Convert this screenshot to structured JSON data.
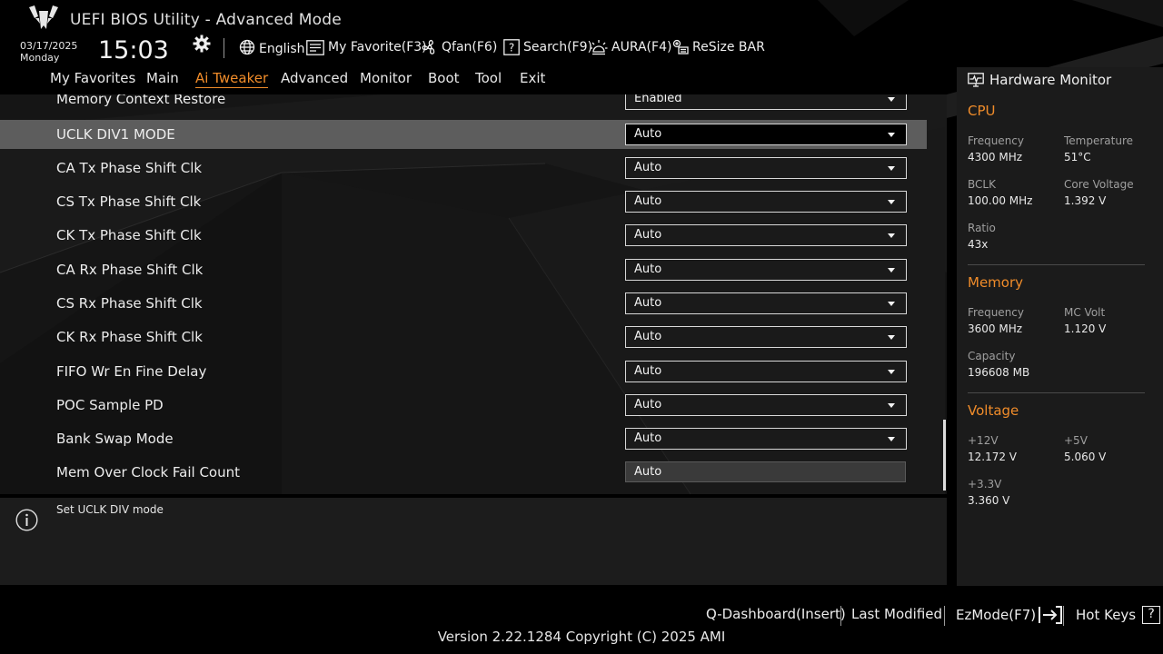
{
  "header": {
    "app_title": "UEFI BIOS Utility - Advanced Mode",
    "date": "03/17/2025",
    "day": "Monday",
    "time": "15:03",
    "toolbar": {
      "language": "English",
      "my_favorite": "My Favorite(F3)",
      "qfan": "Qfan(F6)",
      "search": "Search(F9)",
      "aura": "AURA(F4)",
      "resize_bar": "ReSize BAR"
    }
  },
  "tabs": [
    {
      "label": "My Favorites"
    },
    {
      "label": "Main"
    },
    {
      "label": "Ai Tweaker",
      "active": true
    },
    {
      "label": "Advanced"
    },
    {
      "label": "Monitor"
    },
    {
      "label": "Boot"
    },
    {
      "label": "Tool"
    },
    {
      "label": "Exit"
    }
  ],
  "settings": [
    {
      "label": "Memory Context Restore",
      "value": "Enabled"
    },
    {
      "label": "UCLK DIV1 MODE",
      "value": "Auto",
      "selected": true
    },
    {
      "label": "CA Tx Phase Shift Clk",
      "value": "Auto"
    },
    {
      "label": "CS Tx Phase Shift Clk",
      "value": "Auto"
    },
    {
      "label": "CK Tx Phase Shift Clk",
      "value": "Auto"
    },
    {
      "label": "CA Rx Phase Shift Clk",
      "value": "Auto"
    },
    {
      "label": "CS Rx Phase Shift Clk",
      "value": "Auto"
    },
    {
      "label": "CK Rx Phase Shift Clk",
      "value": "Auto"
    },
    {
      "label": "FIFO Wr En Fine Delay",
      "value": "Auto"
    },
    {
      "label": "POC Sample PD",
      "value": "Auto"
    },
    {
      "label": "Bank Swap Mode",
      "value": "Auto"
    },
    {
      "label": "Mem Over Clock Fail Count",
      "value": "Auto",
      "input": true
    }
  ],
  "help": {
    "text": "Set UCLK DIV mode"
  },
  "hardware_monitor": {
    "title": "Hardware Monitor",
    "cpu": {
      "heading": "CPU",
      "frequency_label": "Frequency",
      "frequency": "4300 MHz",
      "temperature_label": "Temperature",
      "temperature": "51°C",
      "bclk_label": "BCLK",
      "bclk": "100.00 MHz",
      "core_voltage_label": "Core Voltage",
      "core_voltage": "1.392 V",
      "ratio_label": "Ratio",
      "ratio": "43x"
    },
    "memory": {
      "heading": "Memory",
      "frequency_label": "Frequency",
      "frequency": "3600 MHz",
      "mc_volt_label": "MC Volt",
      "mc_volt": "1.120 V",
      "capacity_label": "Capacity",
      "capacity": "196608 MB"
    },
    "voltage": {
      "heading": "Voltage",
      "v12_label": "+12V",
      "v12": "12.172 V",
      "v5_label": "+5V",
      "v5": "5.060 V",
      "v33_label": "+3.3V",
      "v33": "3.360 V"
    }
  },
  "footer": {
    "q_dashboard": "Q-Dashboard(Insert)",
    "last_modified": "Last Modified",
    "ezmode": "EzMode(F7)",
    "hot_keys": "Hot Keys",
    "hot_keys_icon": "?",
    "version": "Version 2.22.1284 Copyright (C) 2025 AMI"
  },
  "colors": {
    "accent": "#f08c2a",
    "background": "#000000",
    "selected_row": "#5d5d5d"
  }
}
